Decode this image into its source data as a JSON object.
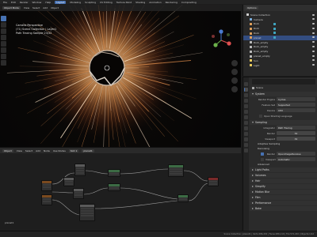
{
  "topbar": {
    "menu": [
      "File",
      "Edit",
      "Render",
      "Window",
      "Help"
    ],
    "workspaces": [
      "Layout",
      "Modeling",
      "Sculpting",
      "UV Editing",
      "Texture Paint",
      "Shading",
      "Animation",
      "Rendering",
      "Compositing"
    ],
    "active_workspace": "Layout"
  },
  "viewport": {
    "mode": "Object Mode",
    "menus": [
      "View",
      "Select",
      "Add",
      "Object"
    ],
    "info_lines": [
      "Camera Perspective",
      "(71) Scene Collection | Layer1",
      "Path Tracing Sample 23/32"
    ]
  },
  "node_editor": {
    "editor_mode": "Object",
    "menus": [
      "View",
      "Select",
      "Add",
      "Node"
    ],
    "use_nodes_label": "Use Nodes",
    "slot": "Slot 1",
    "material": "planet1",
    "footer_label": "planet1"
  },
  "outliner": {
    "header_label": "Options",
    "rows": [
      {
        "label": "Scene Collection",
        "type": "coll",
        "selected": false
      },
      {
        "label": "Camera",
        "type": "cam",
        "selected": false
      },
      {
        "label": "Rock",
        "type": "mesh",
        "selected": false
      },
      {
        "label": "Rock",
        "type": "mesh",
        "selected": false
      },
      {
        "label": "Rock",
        "type": "mesh",
        "selected": false
      },
      {
        "label": "planet",
        "type": "mesh",
        "selected": true
      },
      {
        "label": "Rock_empty",
        "type": "empty",
        "selected": false
      },
      {
        "label": "Rock_empty",
        "type": "empty",
        "selected": false
      },
      {
        "label": "Rock_empty",
        "type": "empty",
        "selected": false
      },
      {
        "label": "planet_empty",
        "type": "empty",
        "selected": false
      },
      {
        "label": "Sun",
        "type": "light",
        "selected": false
      },
      {
        "label": "Light",
        "type": "light",
        "selected": false
      }
    ]
  },
  "properties": {
    "context": "Scene",
    "system": {
      "title": "System",
      "render_engine_label": "Render Engine",
      "render_engine": "Cycles",
      "feature_set_label": "Feature Set",
      "feature_set": "Supported",
      "device_label": "Device",
      "device": "CPU",
      "osl_label": "Open Shading Language"
    },
    "sampling": {
      "title": "Sampling",
      "integrator_label": "Integrator",
      "integrator": "Path Tracing",
      "render_label": "Render",
      "render": "32",
      "viewport_label": "Viewport",
      "viewport": "32",
      "adaptive_label": "Adaptive Sampling",
      "denoising_label": "Denoising",
      "denoiser_render_label": "Render",
      "denoiser_render": "OpenImageDenoise",
      "denoiser_viewport_label": "Viewport",
      "denoiser_viewport": "Automatic",
      "advanced_label": "Advanced"
    },
    "collapsed_panels": [
      "Light Paths",
      "Volumes",
      "Hair",
      "Simplify",
      "Motion Blur",
      "Film",
      "Performance",
      "Bake"
    ]
  },
  "statusbar": {
    "text": "Scene Collection | planet1 | Verts:286,432 | Faces:286,110 | Tris:572,220 | Objects:1/12"
  },
  "colors": {
    "accent": "#4772b3",
    "background": "#1d1d1d",
    "selection": "#334d80",
    "explosion_core": "#f2a25a"
  }
}
